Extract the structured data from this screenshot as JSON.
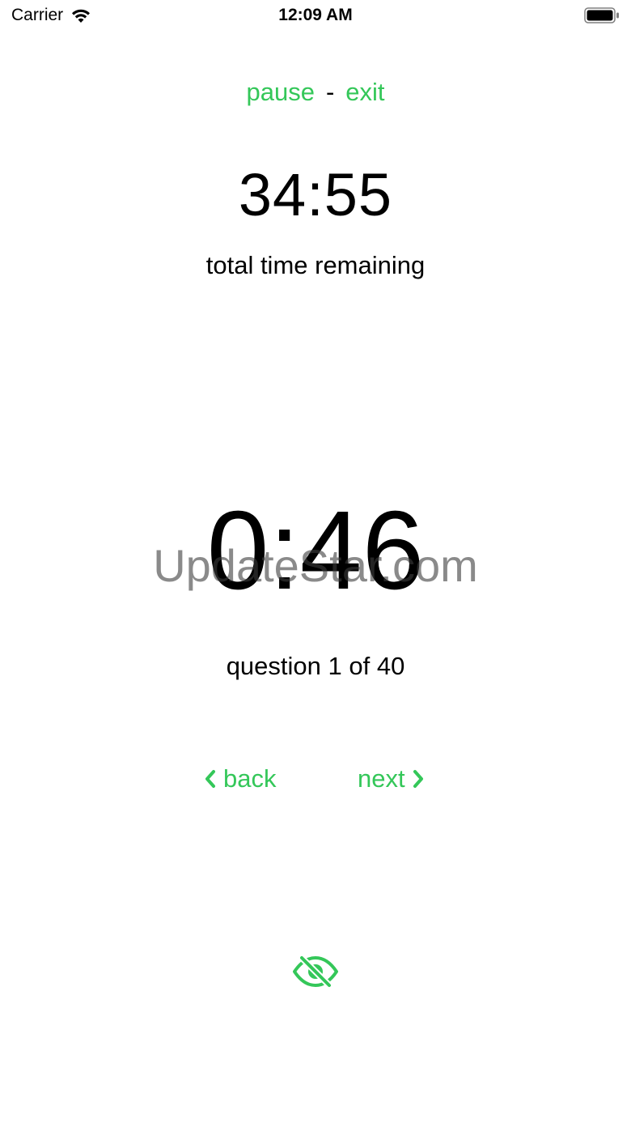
{
  "status_bar": {
    "carrier": "Carrier",
    "time": "12:09 AM",
    "wifi_icon": "wifi-icon",
    "battery_icon": "battery-icon"
  },
  "controls": {
    "pause_label": "pause",
    "separator": "-",
    "exit_label": "exit"
  },
  "total_timer": {
    "value": "34:55",
    "label": "total time remaining"
  },
  "question_timer": {
    "value": "0:46",
    "label": "question 1 of 40"
  },
  "watermark": "UpdateStar.com",
  "navigation": {
    "back_label": "back",
    "next_label": "next",
    "back_icon": "chevron-left-icon",
    "next_icon": "chevron-right-icon"
  },
  "visibility_toggle": {
    "icon": "eye-slash-icon"
  },
  "colors": {
    "accent": "#34c759",
    "text": "#000000",
    "background": "#ffffff"
  }
}
